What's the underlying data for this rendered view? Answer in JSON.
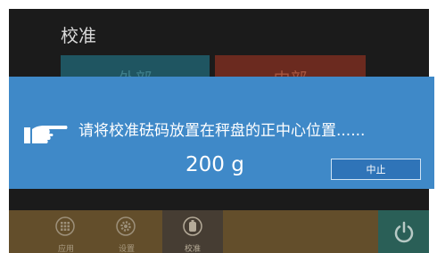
{
  "screen": {
    "title": "校准",
    "mode_buttons": {
      "external": "外部",
      "internal": "内部"
    }
  },
  "dialog": {
    "message": "请将校准砝码放置在秤盘的正中心位置......",
    "weight": "200 g",
    "abort_label": "中止",
    "hand_icon": "pointing-hand-icon"
  },
  "bottom_bar": {
    "items": [
      {
        "label": "应用",
        "icon": "grid-icon"
      },
      {
        "label": "设置",
        "icon": "gear-icon"
      },
      {
        "label": "校准",
        "icon": "calibration-weight-icon"
      }
    ],
    "power_icon": "power-icon"
  },
  "colors": {
    "dialog_bg": "#3f89c8",
    "external_btn": "#1f5561",
    "internal_btn": "#6b2a1f",
    "bottom_bar": "#634e2b",
    "power_btn": "#2a5f57"
  }
}
